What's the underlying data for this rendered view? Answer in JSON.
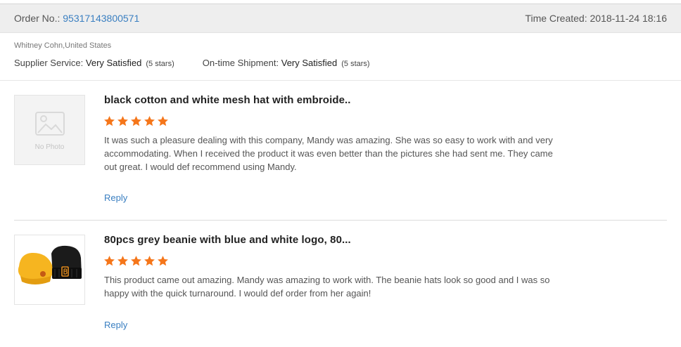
{
  "order": {
    "number_label": "Order No.: ",
    "number": "95317143800571",
    "time_label": "Time Created: ",
    "time": "2018-11-24 18:16"
  },
  "buyer": {
    "name": "Whitney Cohn,United States"
  },
  "ratings": {
    "supplier_label": "Supplier Service: ",
    "supplier_value": "Very Satisfied",
    "supplier_note": "(5 stars)",
    "shipment_label": "On-time Shipment: ",
    "shipment_value": "Very Satisfied",
    "shipment_note": "(5 stars)"
  },
  "reviews": [
    {
      "thumb_text": "No Photo",
      "title": "black cotton and white mesh hat with embroide..",
      "stars": 5,
      "text": "It was such a pleasure dealing with this company, Mandy was amazing.  She was so easy to work with and very accommodating.  When I received the product it was even better than the pictures she had sent me.  They came out great.  I would def recommend using Mandy.",
      "reply_label": "Reply"
    },
    {
      "thumb_text": "",
      "title": "80pcs grey beanie with blue and white logo, 80...",
      "stars": 5,
      "text": "This product came out amazing.  Mandy was amazing to work with. The beanie hats look so good and I was so happy with the quick turnaround.  I would def order from her again!",
      "reply_label": "Reply"
    }
  ],
  "colors": {
    "star": "#f5761a",
    "link": "#3a7fc1",
    "header_bg": "#eeeeee"
  }
}
